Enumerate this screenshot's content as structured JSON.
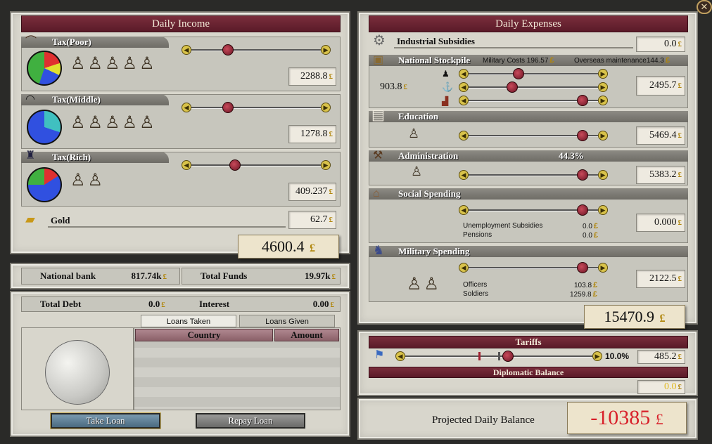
{
  "close_glyph": "✕",
  "currency_glyph": "£",
  "income": {
    "title": "Daily Income",
    "tax_poor": {
      "label": "Tax(Poor)",
      "value": "2288.8",
      "slider_level": 0.27
    },
    "tax_middle": {
      "label": "Tax(Middle)",
      "value": "1278.8",
      "slider_level": 0.27
    },
    "tax_rich": {
      "label": "Tax(Rich)",
      "value": "409.237",
      "slider_level": 0.33
    },
    "gold": {
      "label": "Gold",
      "value": "62.7"
    },
    "total": "4600.4"
  },
  "bank": {
    "national_bank_label": "National bank",
    "national_bank_value": "817.74k",
    "total_funds_label": "Total Funds",
    "total_funds_value": "19.97k"
  },
  "debt": {
    "total_debt_label": "Total Debt",
    "total_debt_value": "0.0",
    "interest_label": "Interest",
    "interest_value": "0.00",
    "tabs": [
      "Loans Taken",
      "Loans Given"
    ],
    "columns": [
      "Country",
      "Amount"
    ],
    "take_loan": "Take Loan",
    "repay_loan": "Repay Loan"
  },
  "expenses": {
    "title": "Daily Expenses",
    "industrial_subsidies": {
      "label": "Industrial Subsidies",
      "value": "0.0"
    },
    "national_stockpile": {
      "label": "National Stockpile",
      "military_costs_label": "Military Costs",
      "military_costs_value": "196.57",
      "overseas_label": "Overseas maintenance",
      "overseas_value": "144.3",
      "stock_value": "903.8",
      "value": "2495.7",
      "slider_levels": [
        0.38,
        0.33,
        0.9
      ]
    },
    "education": {
      "label": "Education",
      "value": "5469.4",
      "slider_level": 0.9
    },
    "administration": {
      "label": "Administration",
      "percent": "44.3%",
      "value": "5383.2",
      "slider_level": 0.9
    },
    "social_spending": {
      "label": "Social Spending",
      "value": "0.000",
      "unemployment_label": "Unemployment Subsidies",
      "unemployment_value": "0.0",
      "pensions_label": "Pensions",
      "pensions_value": "0.0",
      "slider_level": 0.9
    },
    "military_spending": {
      "label": "Military Spending",
      "value": "2122.5",
      "officers_label": "Officers",
      "officers_value": "103.8",
      "soldiers_label": "Soldiers",
      "soldiers_value": "1259.8",
      "slider_level": 0.9
    },
    "total": "15470.9"
  },
  "tariffs": {
    "title": "Tariffs",
    "percent": "10.0%",
    "value": "485.2",
    "slider_level": 0.55
  },
  "diplomatic": {
    "title": "Diplomatic Balance",
    "value": "0.0"
  },
  "projected": {
    "label": "Projected Daily Balance",
    "value": "-10385"
  },
  "colors": {
    "accent": "#6a2030",
    "negative": "#d8202a",
    "gold": "#e0b820"
  }
}
